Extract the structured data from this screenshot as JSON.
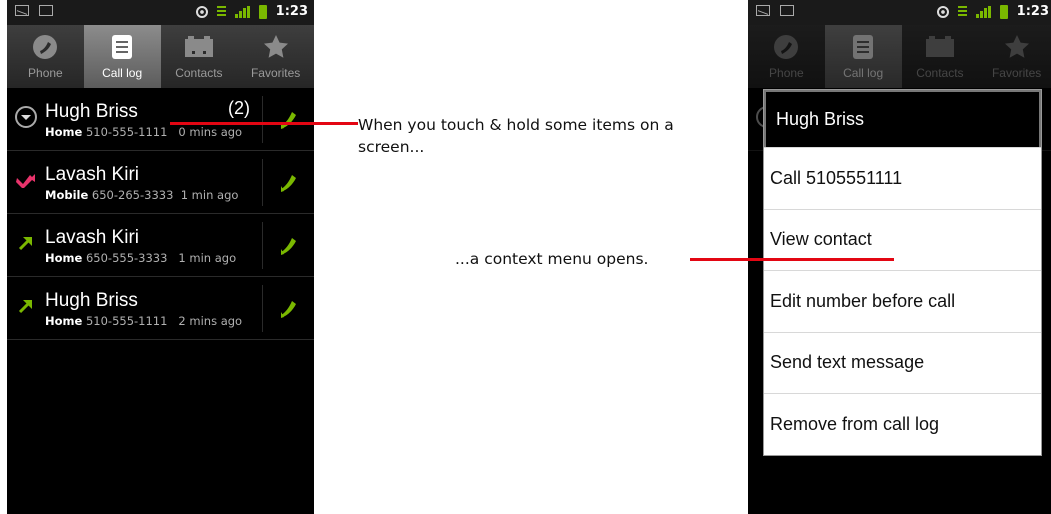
{
  "status_bar": {
    "time": "1:23"
  },
  "tabs": [
    {
      "label": "Phone",
      "icon": "phone-icon",
      "active": false
    },
    {
      "label": "Call log",
      "icon": "call-log-icon",
      "active": true
    },
    {
      "label": "Contacts",
      "icon": "contacts-icon",
      "active": false
    },
    {
      "label": "Favorites",
      "icon": "star-icon",
      "active": false
    }
  ],
  "call_log": [
    {
      "name": "Hugh Briss",
      "type": "Home",
      "number": "510-555-1111",
      "time": "0 mins ago",
      "count": "(2)",
      "icon": "expand-icon"
    },
    {
      "name": "Lavash Kiri",
      "type": "Mobile",
      "number": "650-265-3333",
      "time": "1 min ago",
      "icon": "missed-call-icon"
    },
    {
      "name": "Lavash Kiri",
      "type": "Home",
      "number": "650-555-3333",
      "time": "1 min ago",
      "icon": "outgoing-call-icon"
    },
    {
      "name": "Hugh Briss",
      "type": "Home",
      "number": "510-555-1111",
      "time": "2 mins ago",
      "icon": "outgoing-call-icon"
    }
  ],
  "context_menu": {
    "title": "Hugh Briss",
    "items": [
      "Call 5105551111",
      "View contact",
      "Edit number before call",
      "Send text message",
      "Remove from call log"
    ]
  },
  "annotations": {
    "first": "When you touch & hold some items on a screen...",
    "second": "...a context menu opens."
  },
  "colors": {
    "accent_green": "#7ab800",
    "missed_pink": "#e8336b",
    "pointer_red": "#e30613"
  }
}
